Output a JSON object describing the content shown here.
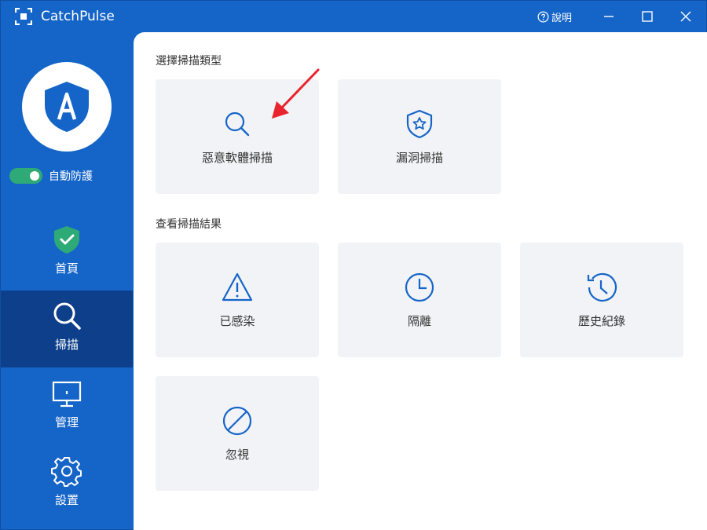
{
  "app": {
    "title": "CatchPulse",
    "help_label": "說明",
    "accent_color": "#1565c8",
    "active_nav_color": "#0d3f8a"
  },
  "sidebar": {
    "auto_protect_label": "自動防護",
    "auto_protect_on": true,
    "items": [
      {
        "label": "首頁",
        "icon": "shield-check-icon",
        "active": false
      },
      {
        "label": "掃描",
        "icon": "search-icon",
        "active": true
      },
      {
        "label": "管理",
        "icon": "monitor-icon",
        "active": false
      },
      {
        "label": "設置",
        "icon": "gear-icon",
        "active": false
      }
    ]
  },
  "main": {
    "section1_title": "選擇掃描類型",
    "section2_title": "查看掃描結果",
    "scan_types": [
      {
        "label": "惡意軟體掃描",
        "icon": "search-icon"
      },
      {
        "label": "漏洞掃描",
        "icon": "shield-star-icon"
      }
    ],
    "results": [
      {
        "label": "已感染",
        "icon": "warning-icon"
      },
      {
        "label": "隔離",
        "icon": "clock-icon"
      },
      {
        "label": "歷史紀錄",
        "icon": "history-icon"
      },
      {
        "label": "忽視",
        "icon": "block-icon"
      }
    ]
  }
}
